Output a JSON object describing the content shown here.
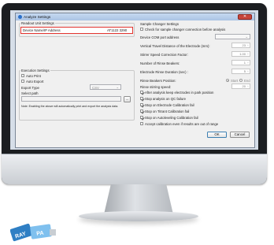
{
  "dialog": {
    "title": "Analyze Settings",
    "close_glyph": "✕",
    "colors": {
      "highlight": "#e3342f",
      "titlebar": "#aac3e4",
      "accent": "#2a6fc9"
    }
  },
  "left": {
    "readout_group": "Readout Unit Settings",
    "device_label": "Device Name/IP Address",
    "device_value": "AT1122 3290",
    "execution_group": "Execution Settings",
    "auto_print": "Auto Print",
    "auto_export": "Auto Export",
    "export_type_label": "Export Type",
    "export_type_value": "CSV",
    "select_path_label": "Select path",
    "browse_label": "...",
    "note": "Note: Enabling the above will automatically print and export the analysis data."
  },
  "right": {
    "changer_group": "Sample Changer Settings",
    "check_connection": "Check for sample changer connection before analysis",
    "com_port_label": "Device COM port address",
    "rows": [
      {
        "label": "Vertical Travel Distance of the Electrode (mm):",
        "value": "23"
      },
      {
        "label": "Stirrer Speed Correction Factor:",
        "value": "1.00"
      },
      {
        "label": "Number of Rinse Beakers:",
        "value": "1"
      },
      {
        "label": "Electrode Rinse Duration (sec) :",
        "value": "5"
      }
    ],
    "rinse_position_label": "Rinse Beakers Position:",
    "rinse_start": "Start",
    "rinse_end": "End",
    "stirring_label": "Rinse stirring speed:",
    "stirring_value": "20",
    "checks": [
      {
        "label": "After analysis keep electrodes in park position",
        "checked": true
      },
      {
        "label": "Stop analysis on QC failure",
        "checked": true
      },
      {
        "label": "Stop on Electrode Calibration fail",
        "checked": true
      },
      {
        "label": "Stop on Titrant Calibration fail",
        "checked": true
      },
      {
        "label": "Stop on Autoleveling Calibration fail",
        "checked": true
      },
      {
        "label": "Accept calibration even if results are out of range",
        "checked": false
      }
    ],
    "ok_label": "OK",
    "cancel_label": "Cancel"
  },
  "usb": {
    "logo_left": "RAY",
    "logo_right": "PA"
  }
}
